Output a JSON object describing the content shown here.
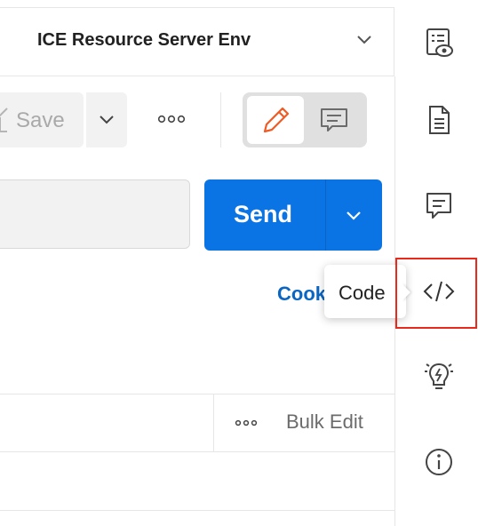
{
  "environment": {
    "name": "ICE Resource Server Env",
    "chevron_icon": "chevron-down-icon",
    "quick_look_icon": "environment-quick-look-icon"
  },
  "toolbar": {
    "save_label": "Save",
    "save_icon": "save-icon",
    "save_dropdown_icon": "chevron-down-icon",
    "more_icon": "more-options-icon",
    "edit_mode_icon": "pencil-icon",
    "comment_mode_icon": "comment-icon"
  },
  "request": {
    "url_value": "",
    "send_label": "Send",
    "send_dropdown_icon": "chevron-down-icon",
    "cookies_label": "Cookies"
  },
  "tooltip": {
    "text": "Code"
  },
  "sidebar": {
    "items": [
      {
        "name": "documentation",
        "icon": "document-icon"
      },
      {
        "name": "comments",
        "icon": "comment-icon"
      },
      {
        "name": "code",
        "icon": "code-icon"
      },
      {
        "name": "related",
        "icon": "lightbulb-icon"
      },
      {
        "name": "info",
        "icon": "info-icon"
      }
    ]
  },
  "params": {
    "more_icon": "more-options-icon",
    "bulk_edit_label": "Bulk Edit"
  },
  "colors": {
    "send": "#0b74e5",
    "cookies_link": "#0b66c3",
    "pencil": "#ef5b25",
    "highlight": "#e8291c"
  }
}
